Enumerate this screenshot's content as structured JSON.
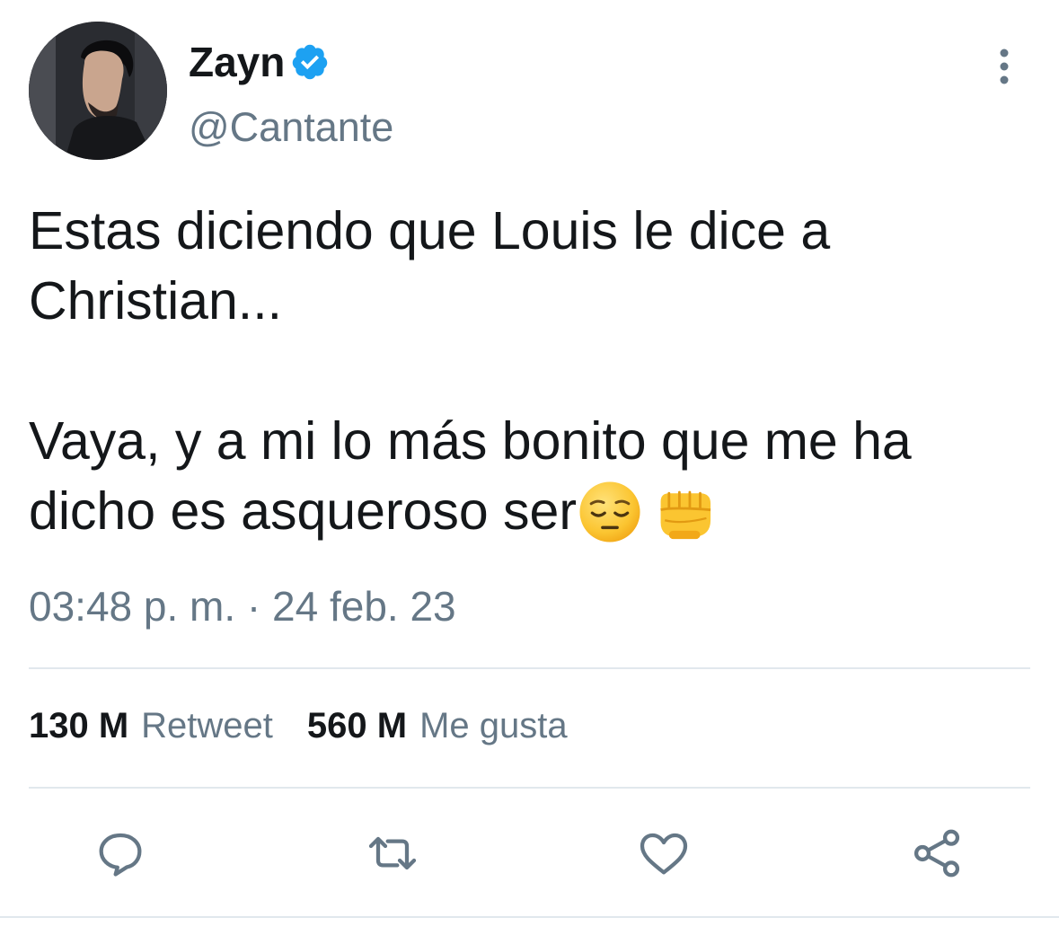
{
  "tweet": {
    "author": {
      "display_name": "Zayn",
      "handle": "@Cantante",
      "verified": true
    },
    "text": {
      "line1": "Estas diciendo que Louis le dice a Christian...",
      "line2": "Vaya, y a mi lo más bonito que me ha dicho es asqueroso ser",
      "emojis": [
        "pensive-face",
        "oncoming-fist"
      ]
    },
    "timestamp": "03:48 p. m. · 24 feb. 23",
    "stats": {
      "retweets_count": "130 M",
      "retweets_label": "Retweet",
      "likes_count": "560 M",
      "likes_label": "Me gusta"
    },
    "actions": [
      "reply-icon",
      "retweet-icon",
      "like-icon",
      "share-icon"
    ],
    "colors": {
      "text": "#14171a",
      "secondary": "#657786",
      "verified": "#1da1f2",
      "divider": "#e1e8ed"
    }
  }
}
